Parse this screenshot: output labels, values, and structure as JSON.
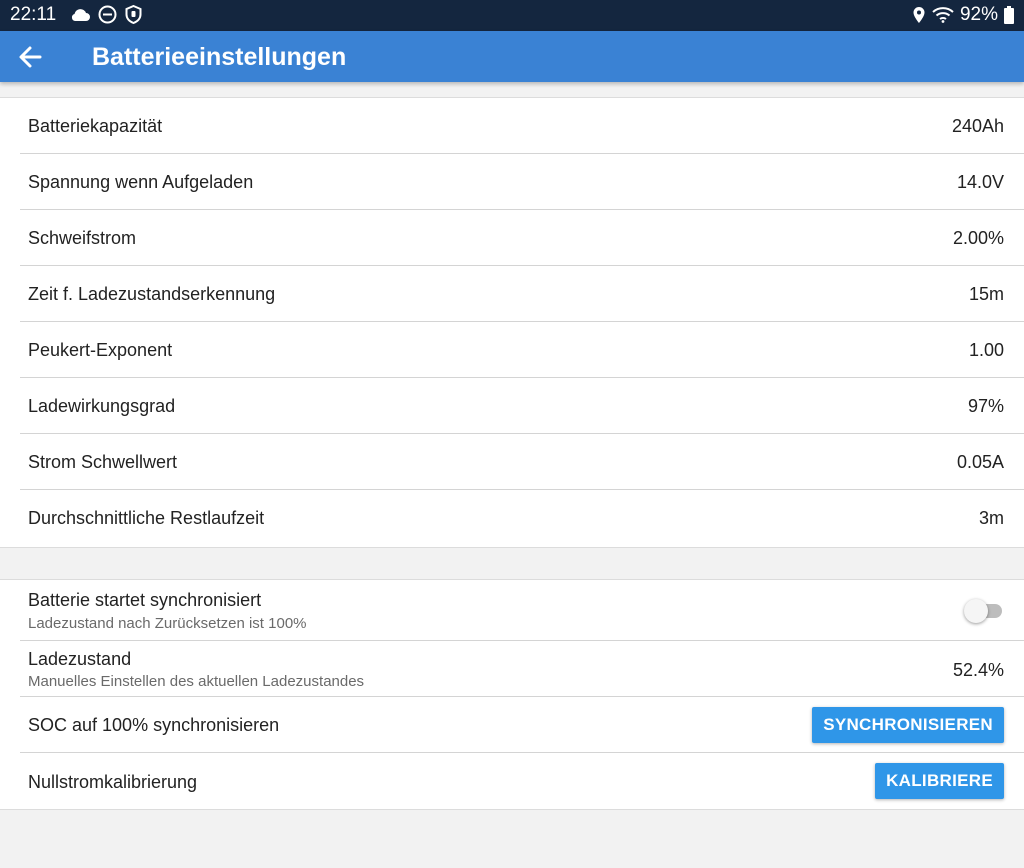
{
  "status_bar": {
    "time": "22:11",
    "battery_percent": "92%",
    "left_icons": [
      "cloud-icon",
      "do-not-disturb-icon",
      "shield-icon"
    ],
    "right_icons": [
      "location-icon",
      "wifi-icon",
      "battery-icon"
    ]
  },
  "app_bar": {
    "title": "Batterieeinstellungen",
    "back_icon": "arrow-left-icon"
  },
  "settings": [
    {
      "label": "Batteriekapazität",
      "value": "240Ah"
    },
    {
      "label": "Spannung wenn Aufgeladen",
      "value": "14.0V"
    },
    {
      "label": "Schweifstrom",
      "value": "2.00%"
    },
    {
      "label": "Zeit f. Ladezustandserkennung",
      "value": "15m"
    },
    {
      "label": "Peukert-Exponent",
      "value": "1.00"
    },
    {
      "label": "Ladewirkungsgrad",
      "value": "97%"
    },
    {
      "label": "Strom Schwellwert",
      "value": "0.05A"
    },
    {
      "label": "Durchschnittliche Restlaufzeit",
      "value": "3m"
    }
  ],
  "sync_section": {
    "start_synced": {
      "title": "Batterie startet synchronisiert",
      "subtitle": "Ladezustand nach Zurücksetzen ist 100%",
      "toggle_on": false
    },
    "soc": {
      "title": "Ladezustand",
      "subtitle": "Manuelles Einstellen des aktuellen Ladezustandes",
      "value": "52.4%"
    },
    "sync_soc": {
      "title": "SOC auf 100% synchronisieren",
      "button_label": "SYNCHRONISIEREN"
    },
    "zero_calibration": {
      "title": "Nullstromkalibrierung",
      "button_label": "KALIBRIERE"
    }
  },
  "colors": {
    "status_bar": "#14263f",
    "app_bar": "#3a82d4",
    "button": "#2f96e8",
    "background": "#f2f2f2"
  }
}
